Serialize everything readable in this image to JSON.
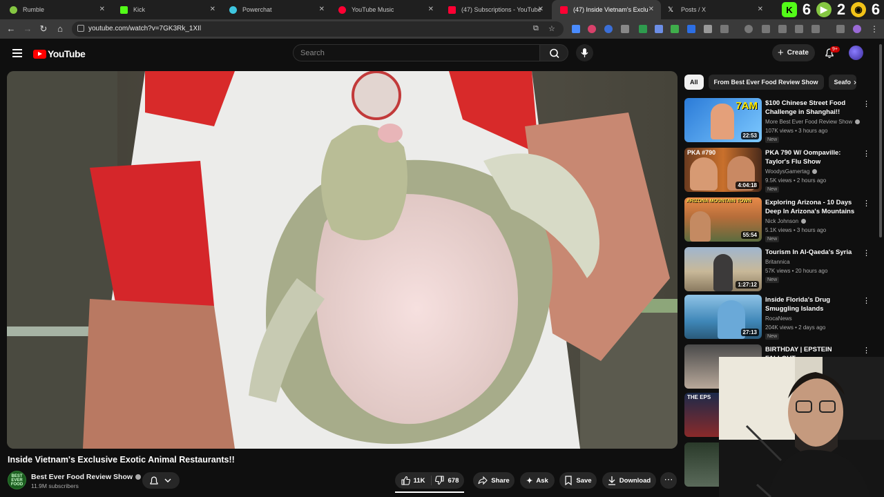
{
  "browser": {
    "tabs": [
      {
        "label": "Rumble",
        "icon": "rumble-icon",
        "color": "#85c742"
      },
      {
        "label": "Kick",
        "icon": "kick-icon",
        "color": "#53fc18"
      },
      {
        "label": "Powerchat",
        "icon": "powerchat-icon",
        "color": "#3ec6e0"
      },
      {
        "label": "YouTube Music",
        "icon": "youtube-music-icon",
        "color": "#ff0033"
      },
      {
        "label": "(47) Subscriptions - YouTube",
        "icon": "youtube-icon",
        "color": "#ff0033"
      },
      {
        "label": "(47) Inside Vietnam's Exclusive E",
        "icon": "youtube-icon",
        "color": "#ff0033"
      },
      {
        "label": "Posts / X",
        "icon": "x-icon",
        "color": "#ffffff"
      }
    ],
    "extension_counters": [
      "6",
      "2",
      "6"
    ],
    "url": "youtube.com/watch?v=7GK3Rk_1XIl"
  },
  "youtube": {
    "logo_text": "YouTube",
    "search_placeholder": "Search",
    "create_label": "Create",
    "notification_count": "9+"
  },
  "video": {
    "title": "Inside Vietnam's Exclusive Exotic Animal Restaurants!!",
    "channel": "Best Ever Food Review Show",
    "channel_avatar_text": "BEST EVER FOOD",
    "subscribers": "11.9M subscribers",
    "likes": "11K",
    "dislikes": "678",
    "share_label": "Share",
    "ask_label": "Ask",
    "save_label": "Save",
    "download_label": "Download"
  },
  "chips": [
    "All",
    "From Best Ever Food Review Show",
    "Seafo"
  ],
  "recommendations": [
    {
      "title": "$100 Chinese Street Food Challenge in Shanghai!!",
      "channel": "More Best Ever Food Review Show",
      "verified": true,
      "meta": "107K views • 3 hours ago",
      "badge": "New",
      "duration": "22:53",
      "thumb_overlay": "7AM"
    },
    {
      "title": "PKA 790 W/ Oompaville: Taylor's Flu Show",
      "channel": "WoodysGamertag",
      "verified": true,
      "meta": "9.5K views • 2 hours ago",
      "badge": "New",
      "duration": "4:04:18",
      "thumb_overlay": "PKA #790"
    },
    {
      "title": "Exploring Arizona - 10 Days Deep In Arizona's Mountains",
      "channel": "Nick Johnson",
      "verified": true,
      "meta": "5.1K views • 3 hours ago",
      "badge": "New",
      "duration": "55:54",
      "thumb_overlay": "ARIZONA MOUNTAIN TOWN"
    },
    {
      "title": "Tourism In Al-Qaeda's Syria",
      "channel": "Britannica",
      "verified": false,
      "meta": "57K views • 20 hours ago",
      "badge": "New",
      "duration": "1:27:12",
      "thumb_overlay": ""
    },
    {
      "title": "Inside Florida's Drug Smuggling Islands",
      "channel": "RocaNews",
      "verified": false,
      "meta": "204K views • 2 days ago",
      "badge": "New",
      "duration": "27:13",
      "thumb_overlay": ""
    },
    {
      "title": "BIRTHDAY | EPSTEIN FALLOUT",
      "channel": "",
      "verified": false,
      "meta": "",
      "badge": "",
      "duration": "",
      "thumb_overlay": ""
    },
    {
      "title": "",
      "channel": "",
      "verified": false,
      "meta": "",
      "badge": "",
      "duration": "",
      "thumb_overlay": "THE EPS"
    }
  ]
}
